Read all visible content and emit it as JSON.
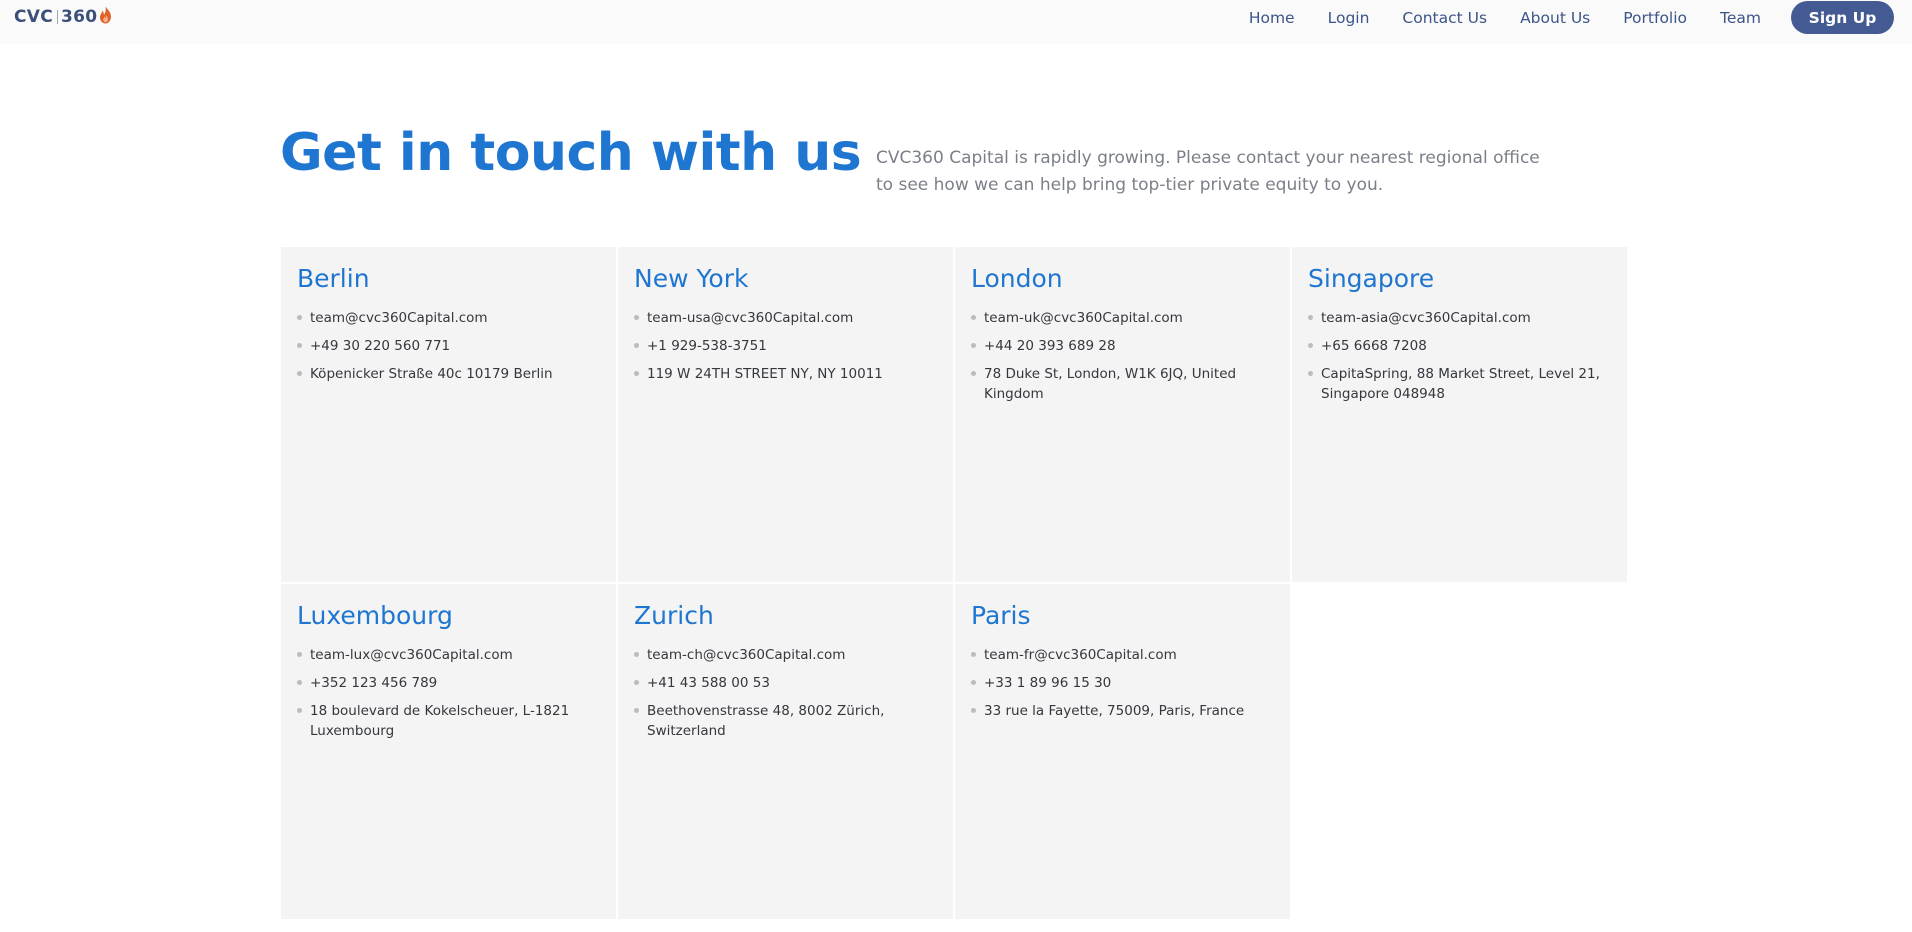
{
  "header": {
    "logo": {
      "left_text": "CVC",
      "right_text": "360",
      "icon": "flame-icon",
      "icon_color": "#e0622b"
    },
    "nav": [
      {
        "label": "Home"
      },
      {
        "label": "Login"
      },
      {
        "label": "Contact Us"
      },
      {
        "label": "About Us"
      },
      {
        "label": "Portfolio"
      },
      {
        "label": "Team"
      }
    ],
    "signup_label": "Sign Up"
  },
  "hero": {
    "title": "Get in touch with us",
    "description": "CVC360 Capital is rapidly growing. Please contact your nearest regional office to see how we can help bring top-tier private equity to you."
  },
  "offices": [
    {
      "city": "Berlin",
      "email": "team@cvc360Capital.com",
      "phone": "+49 30 220 560 771",
      "address": "Köpenicker Straße 40c 10179 Berlin"
    },
    {
      "city": "New York",
      "email": "team-usa@cvc360Capital.com",
      "phone": "+1 929-538-3751",
      "address": "119 W 24TH STREET NY, NY 10011"
    },
    {
      "city": "London",
      "email": "team-uk@cvc360Capital.com",
      "phone": "+44 20 393 689 28",
      "address": "78 Duke St, London, W1K 6JQ, United Kingdom"
    },
    {
      "city": "Singapore",
      "email": "team-asia@cvc360Capital.com",
      "phone": "+65 6668 7208",
      "address": "CapitaSpring, 88 Market Street, Level 21, Singapore 048948"
    },
    {
      "city": "Luxembourg",
      "email": "team-lux@cvc360Capital.com",
      "phone": "+352 123 456 789",
      "address": "18 boulevard de Kokelscheuer, L-1821 Luxembourg"
    },
    {
      "city": "Zurich",
      "email": "team-ch@cvc360Capital.com",
      "phone": "+41 43 588 00 53",
      "address": "Beethovenstrasse 48, 8002 Zürich, Switzerland"
    },
    {
      "city": "Paris",
      "email": "team-fr@cvc360Capital.com",
      "phone": "+33 1 89 96 15 30",
      "address": "33 rue la Fayette, 75009, Paris, France"
    }
  ],
  "colors": {
    "accent": "#1f76d0",
    "nav_text": "#3c5588",
    "signup_bg": "#445a93",
    "card_bg": "#f4f4f4",
    "muted_text": "#7b7f88"
  }
}
